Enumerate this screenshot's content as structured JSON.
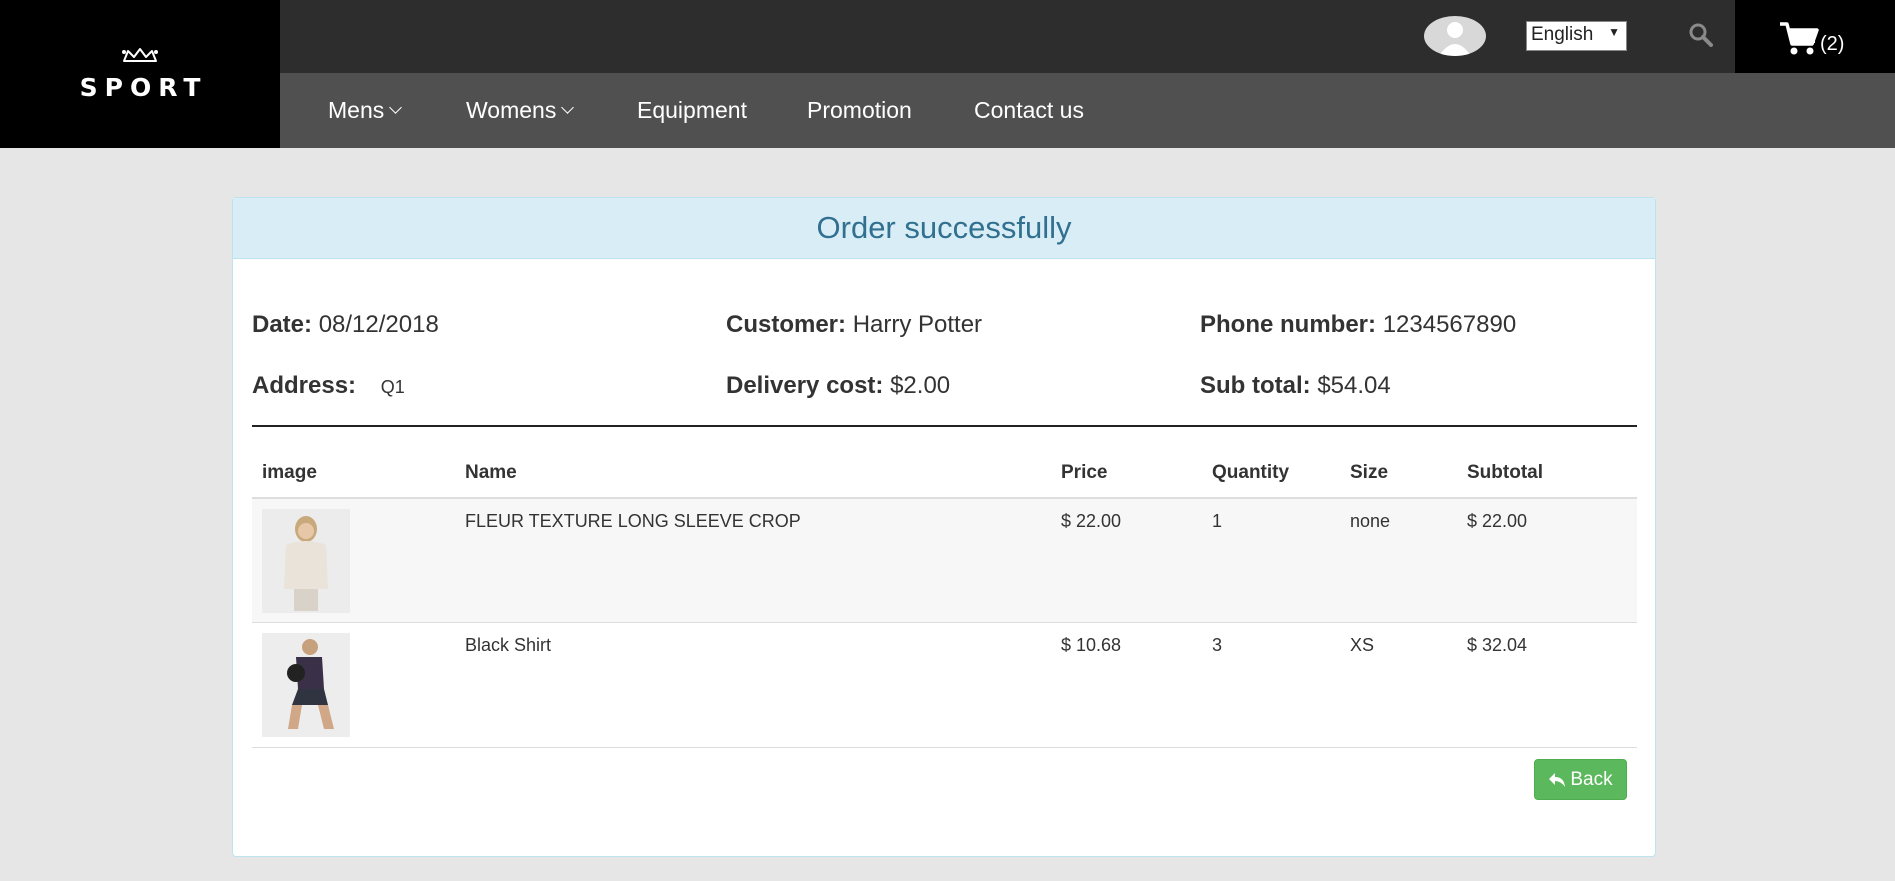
{
  "brand": {
    "logo_text": "SPORT"
  },
  "header": {
    "language_selected": "English",
    "cart_count": "(2)"
  },
  "nav": {
    "items": [
      {
        "label": "Mens",
        "has_dropdown": true
      },
      {
        "label": "Womens",
        "has_dropdown": true
      },
      {
        "label": "Equipment",
        "has_dropdown": false
      },
      {
        "label": "Promotion",
        "has_dropdown": false
      },
      {
        "label": "Contact us",
        "has_dropdown": false
      }
    ]
  },
  "order": {
    "heading": "Order successfully",
    "date_label": "Date:",
    "date": "08/12/2018",
    "customer_label": "Customer:",
    "customer": "Harry Potter",
    "phone_label": "Phone number:",
    "phone": "1234567890",
    "address_label": "Address:",
    "address": "Q1",
    "delivery_label": "Delivery cost:",
    "delivery": "$2.00",
    "subtotal_label": "Sub total:",
    "subtotal": "$54.04"
  },
  "table": {
    "headers": [
      "image",
      "Name",
      "Price",
      "Quantity",
      "Size",
      "Subtotal"
    ],
    "rows": [
      {
        "name": "FLEUR TEXTURE LONG SLEEVE CROP",
        "price": "$ 22.00",
        "quantity": "1",
        "size": "none",
        "subtotal": "$ 22.00"
      },
      {
        "name": "Black Shirt",
        "price": "$ 10.68",
        "quantity": "3",
        "size": "XS",
        "subtotal": "$ 32.04"
      }
    ]
  },
  "actions": {
    "back_label": "Back"
  },
  "colors": {
    "header_dark": "#2d2d2d",
    "nav_bg": "#505050",
    "panel_heading_bg": "#d9edf7",
    "panel_heading_text": "#31708f",
    "back_button": "#5cb85c"
  }
}
